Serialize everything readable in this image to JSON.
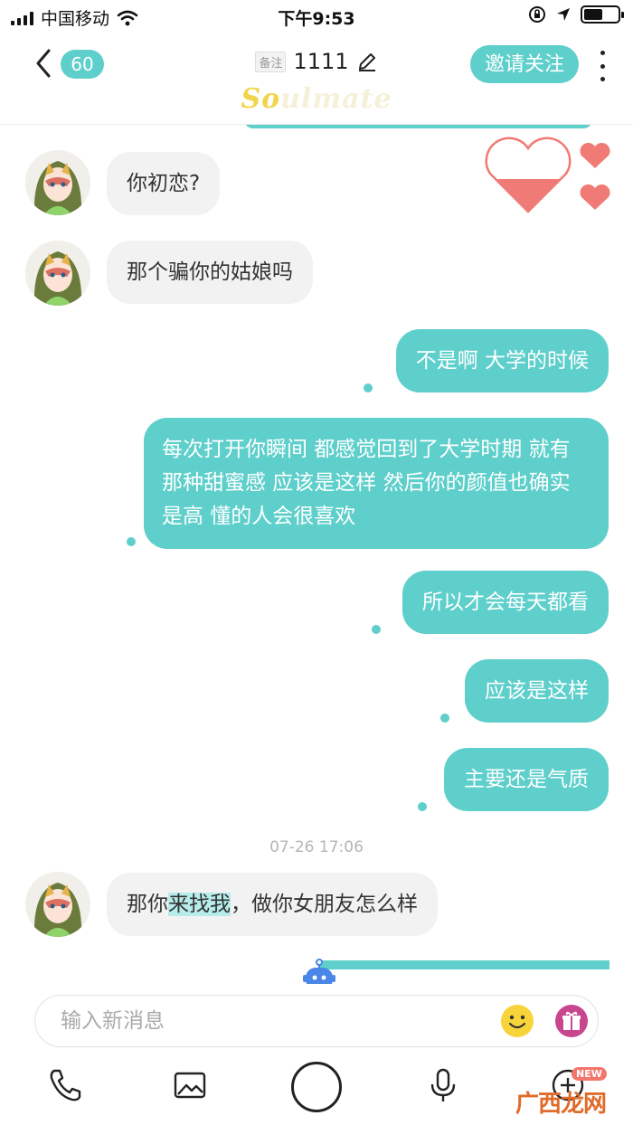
{
  "status_bar": {
    "carrier": "中国移动",
    "time": "下午9:53",
    "battery_level": 0.55
  },
  "header": {
    "unread_count": "60",
    "remark_tag": "备注",
    "title": "1111",
    "brand_so": "So",
    "brand_rest": "ulmate",
    "follow_label": "邀请关注"
  },
  "messages": [
    {
      "side": "in",
      "text": "你初恋?"
    },
    {
      "side": "in",
      "text": "那个骗你的姑娘吗"
    },
    {
      "side": "out",
      "text": "不是啊 大学的时候"
    },
    {
      "side": "out",
      "text": "每次打开你瞬间 都感觉回到了大学时期 就有那种甜蜜感 应该是这样 然后你的颜值也确实是高 懂的人会很喜欢"
    },
    {
      "side": "out",
      "text": "所以才会每天都看"
    },
    {
      "side": "out",
      "text": "应该是这样"
    },
    {
      "side": "out",
      "text": "主要还是气质"
    }
  ],
  "timestamp": "07-26 17:06",
  "last_message": {
    "before": "那你",
    "highlight": "来找我",
    "after": "，做你女朋友怎么样"
  },
  "input": {
    "placeholder": "输入新消息"
  },
  "toolbar": {
    "new_badge": "NEW"
  },
  "watermark": "广西龙网",
  "colors": {
    "accent": "#5ecfcb",
    "incoming_bubble": "#f2f2f2",
    "heart": "#f07a75"
  }
}
